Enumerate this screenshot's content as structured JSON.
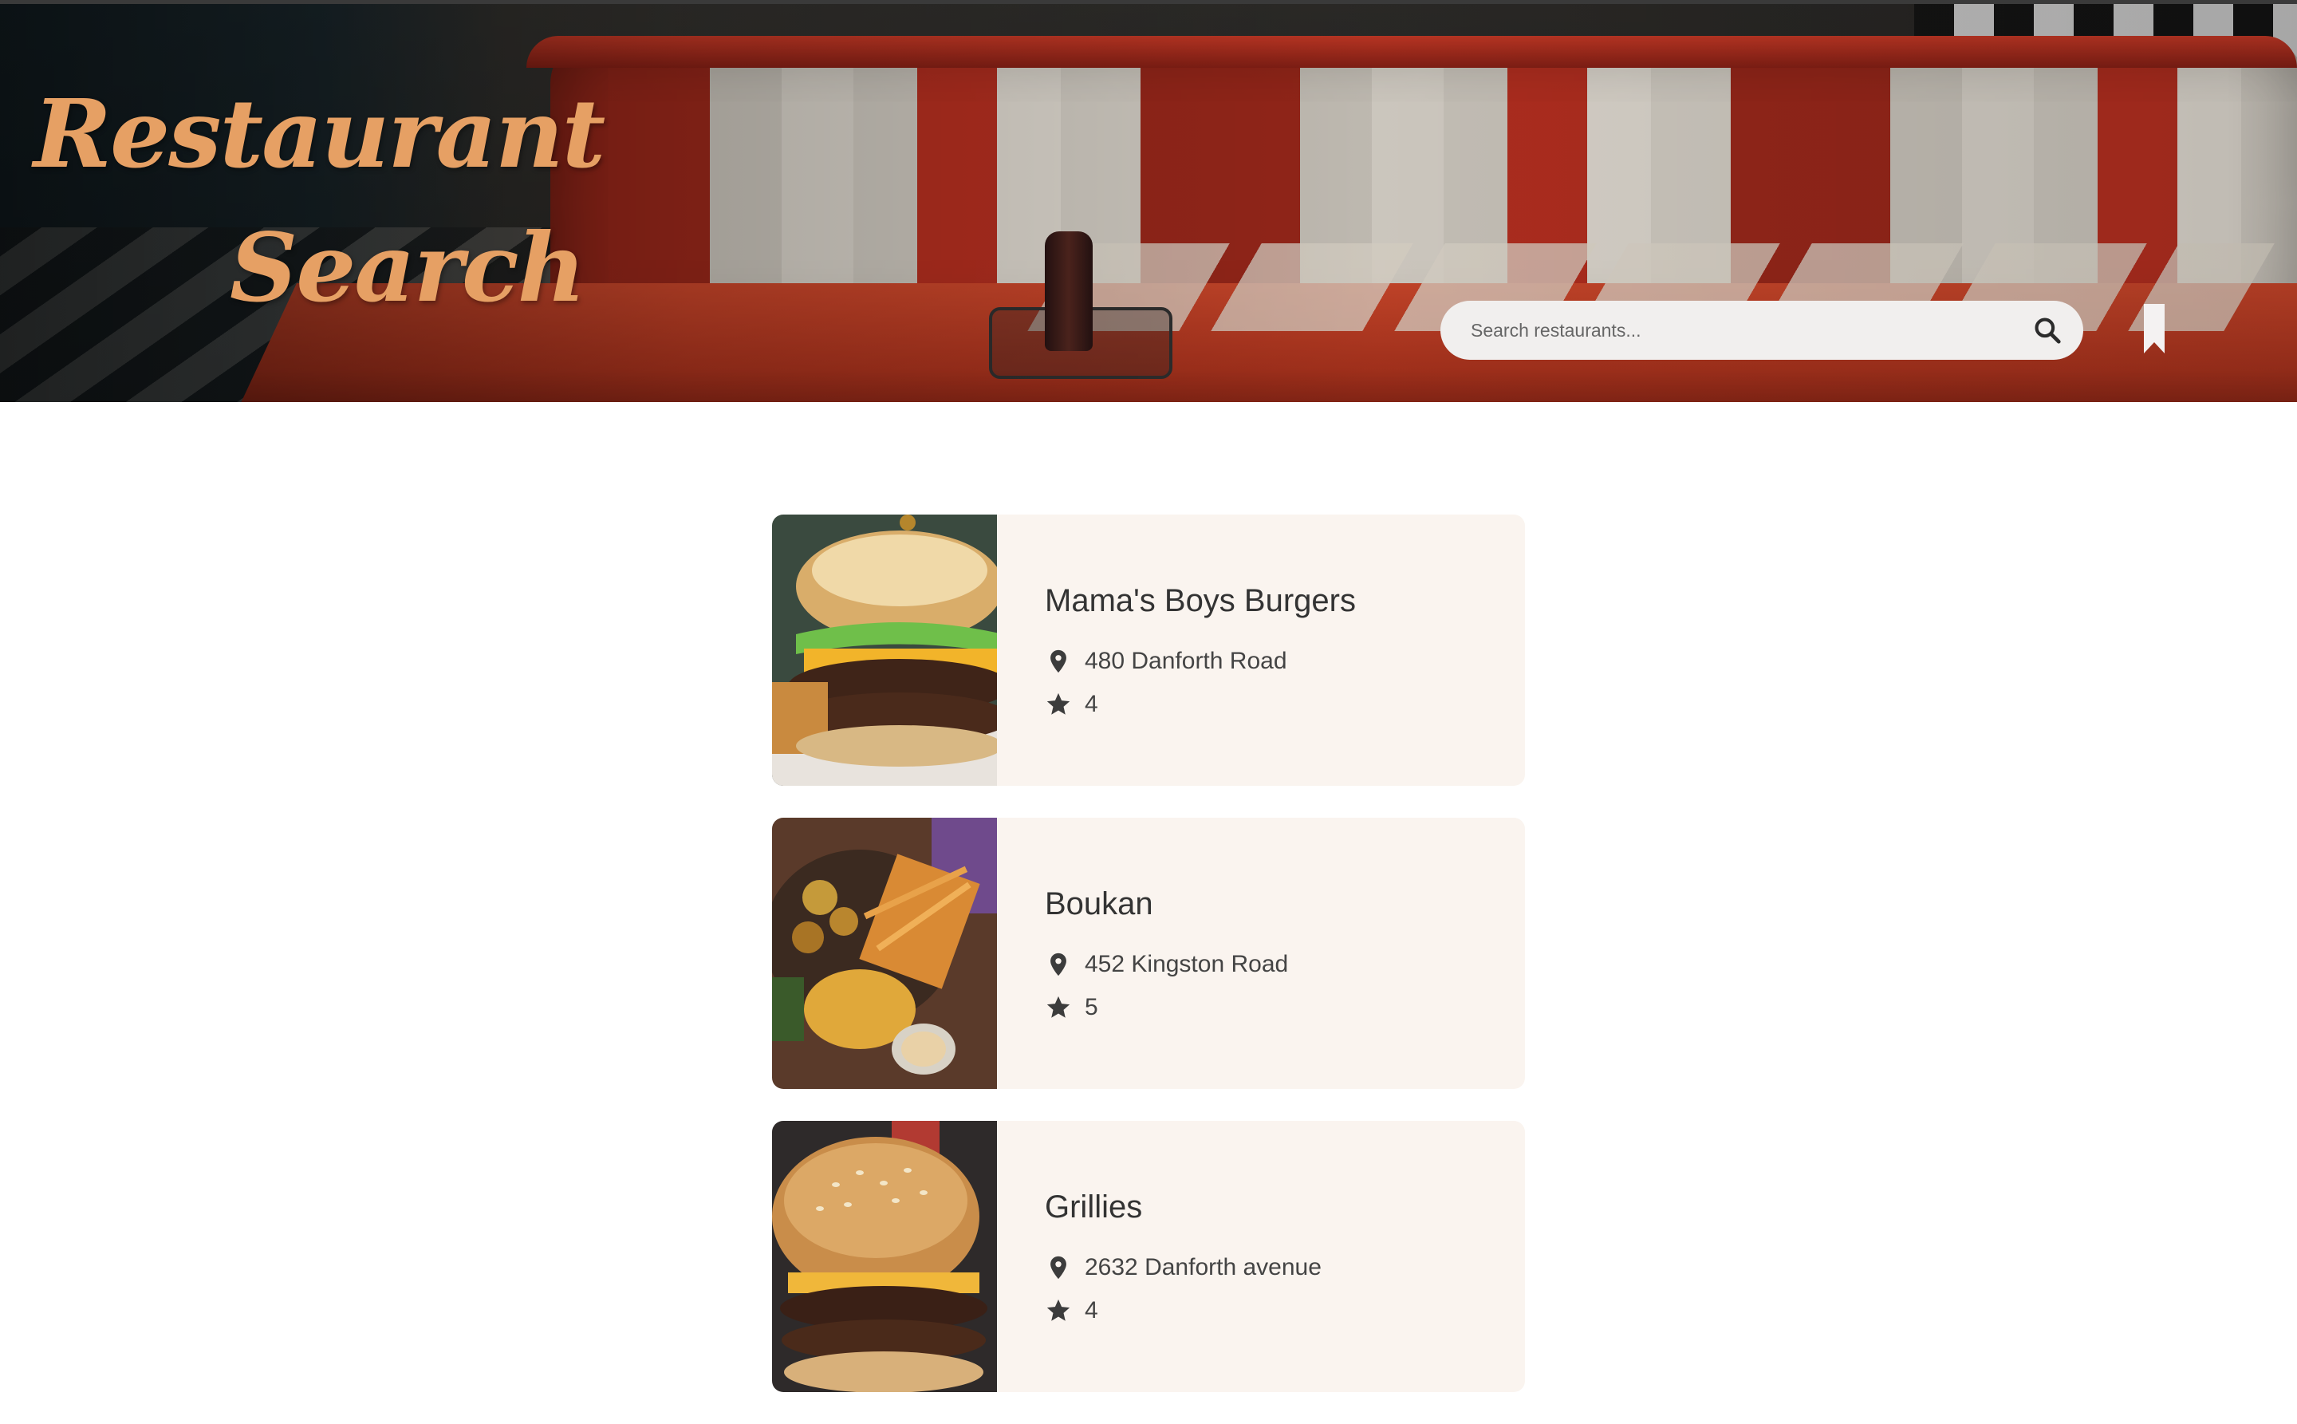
{
  "header": {
    "title_line_1": "Restaurant",
    "title_line_2": "Search",
    "title_color": "#e6a064"
  },
  "search": {
    "placeholder": "Search restaurants...",
    "value": ""
  },
  "icons": {
    "search": "search-icon",
    "bookmark": "bookmark-icon",
    "location": "map-pin-icon",
    "rating": "star-icon"
  },
  "restaurants": [
    {
      "name": "Mama's Boys Burgers",
      "address": "480 Danforth Road",
      "rating": "4"
    },
    {
      "name": "Boukan",
      "address": "452 Kingston Road",
      "rating": "5"
    },
    {
      "name": "Grillies",
      "address": "2632 Danforth avenue",
      "rating": "4"
    }
  ]
}
